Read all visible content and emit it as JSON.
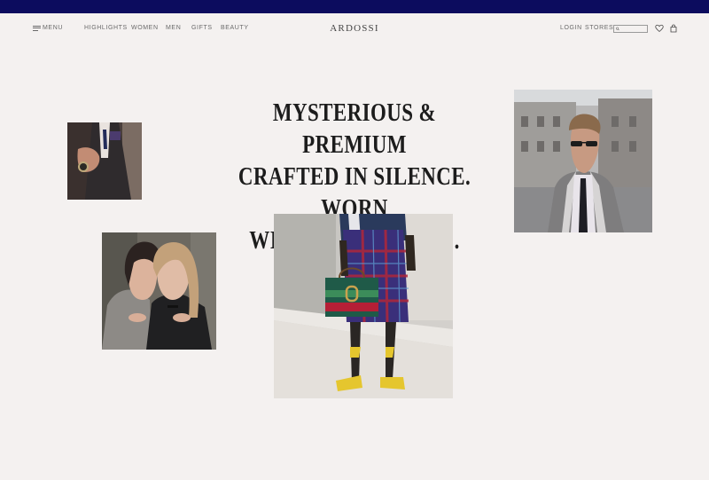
{
  "brand": "ARDOSSI",
  "nav": {
    "menu_label": "MENU",
    "links": [
      "HIGHLIGHTS",
      "WOMEN",
      "MEN",
      "GIFTS",
      "BEAUTY"
    ],
    "right_links": [
      "LOGIN",
      "STORES"
    ],
    "search_placeholder": ""
  },
  "hero": {
    "line1": "MYSTERIOUS & PREMIUM",
    "line2": "CRAFTED IN SILENCE. WORN",
    "line3": "WITH CONFIDENCE."
  },
  "colors": {
    "top_bar": "#0c0c5e",
    "background": "#f4f1f0",
    "headline": "#1c1c1c"
  },
  "icons": [
    "hamburger-icon",
    "search-icon",
    "heart-icon",
    "shopping-bag-icon"
  ]
}
